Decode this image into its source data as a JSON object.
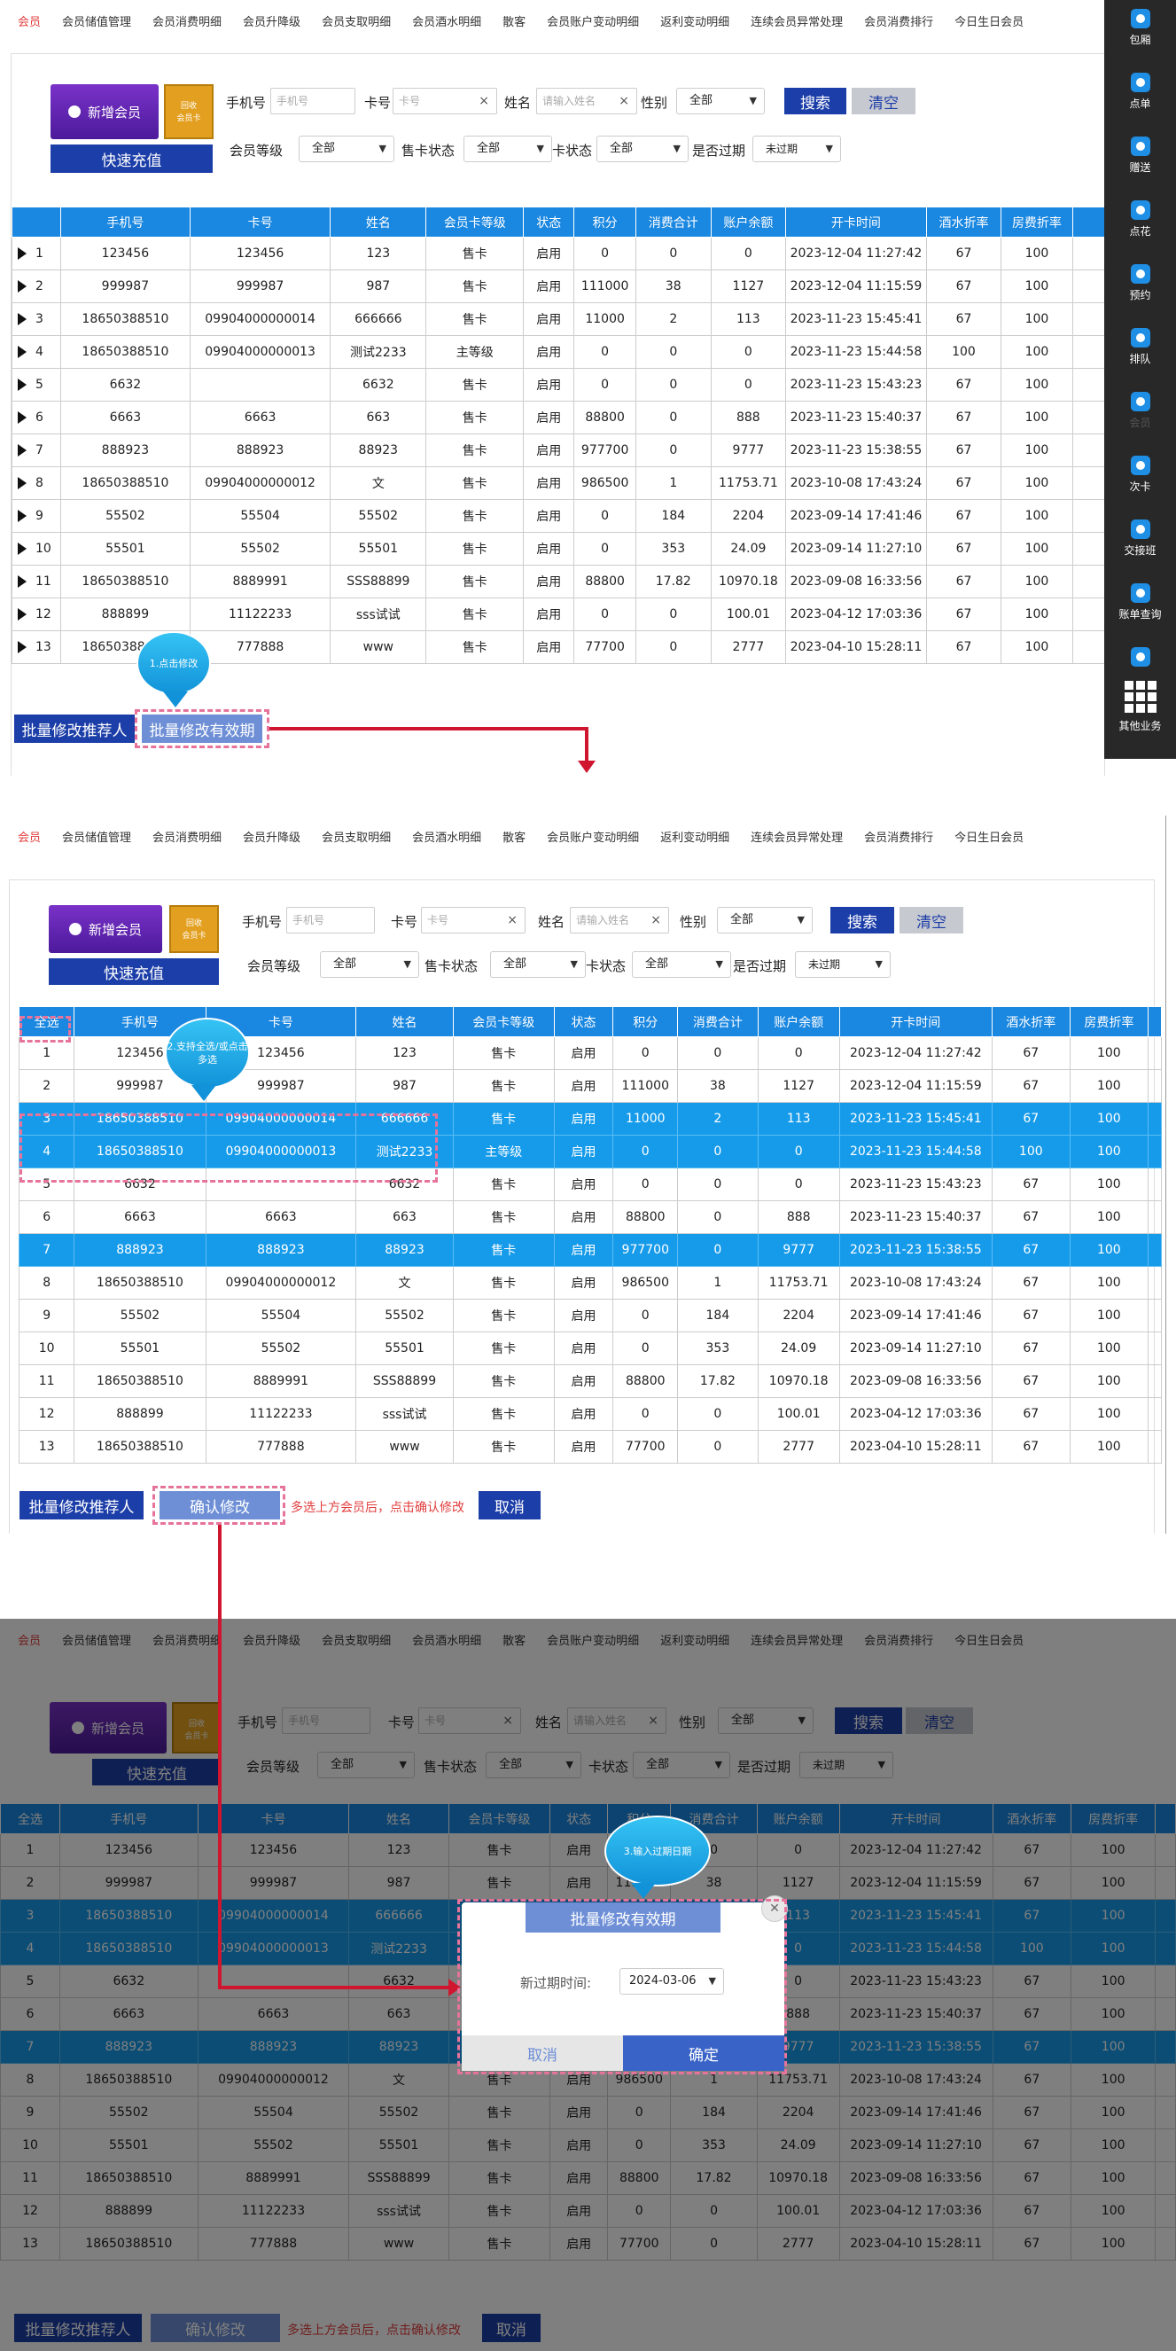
{
  "tabs": [
    "会员",
    "会员储值管理",
    "会员消费明细",
    "会员升降级",
    "会员支取明细",
    "会员酒水明细",
    "散客",
    "会员账户变动明细",
    "返利变动明细",
    "连续会员异常处理",
    "会员消费排行",
    "今日生日会员"
  ],
  "toolbar": {
    "new_member": "新增会员",
    "recycle_line1": "回收",
    "recycle_line2": "会员卡",
    "recharge": "快速充值",
    "phone_label": "手机号",
    "phone_placeholder": "手机号",
    "card_label": "卡号",
    "card_placeholder": "卡号",
    "name_label": "姓名",
    "name_placeholder": "请输入姓名",
    "gender_label": "性别",
    "gender_value": "全部",
    "search": "搜索",
    "clear": "清空",
    "level_label": "会员等级",
    "level_value": "全部",
    "sale_status_label": "售卡状态",
    "sale_status_value": "全部",
    "card_status_label": "卡状态",
    "card_status_value": "全部",
    "expired_label": "是否过期",
    "expired_value": "未过期"
  },
  "columns": [
    "手机号",
    "卡号",
    "姓名",
    "会员卡等级",
    "状态",
    "积分",
    "消费合计",
    "账户余额",
    "开卡时间",
    "酒水折率",
    "房费折率"
  ],
  "select_all": "全选",
  "rows": [
    {
      "no": "1",
      "phone": "123456",
      "card": "123456",
      "name": "123",
      "level": "售卡",
      "status": "启用",
      "points": "0",
      "consume": "0",
      "balance": "0",
      "open": "2023-12-04 11:27:42",
      "drink": "67",
      "room": "100"
    },
    {
      "no": "2",
      "phone": "999987",
      "card": "999987",
      "name": "987",
      "level": "售卡",
      "status": "启用",
      "points": "111000",
      "consume": "38",
      "balance": "1127",
      "open": "2023-12-04 11:15:59",
      "drink": "67",
      "room": "100"
    },
    {
      "no": "3",
      "phone": "18650388510",
      "card": "09904000000014",
      "name": "666666",
      "level": "售卡",
      "status": "启用",
      "points": "11000",
      "consume": "2",
      "balance": "113",
      "open": "2023-11-23 15:45:41",
      "drink": "67",
      "room": "100"
    },
    {
      "no": "4",
      "phone": "18650388510",
      "card": "09904000000013",
      "name": "测试2233",
      "level": "主等级",
      "status": "启用",
      "points": "0",
      "consume": "0",
      "balance": "0",
      "open": "2023-11-23 15:44:58",
      "drink": "100",
      "room": "100"
    },
    {
      "no": "5",
      "phone": "6632",
      "card": "",
      "name": "6632",
      "level": "售卡",
      "status": "启用",
      "points": "0",
      "consume": "0",
      "balance": "0",
      "open": "2023-11-23 15:43:23",
      "drink": "67",
      "room": "100"
    },
    {
      "no": "6",
      "phone": "6663",
      "card": "6663",
      "name": "663",
      "level": "售卡",
      "status": "启用",
      "points": "88800",
      "consume": "0",
      "balance": "888",
      "open": "2023-11-23 15:40:37",
      "drink": "67",
      "room": "100"
    },
    {
      "no": "7",
      "phone": "888923",
      "card": "888923",
      "name": "88923",
      "level": "售卡",
      "status": "启用",
      "points": "977700",
      "consume": "0",
      "balance": "9777",
      "open": "2023-11-23 15:38:55",
      "drink": "67",
      "room": "100"
    },
    {
      "no": "8",
      "phone": "18650388510",
      "card": "09904000000012",
      "name": "文",
      "level": "售卡",
      "status": "启用",
      "points": "986500",
      "consume": "1",
      "balance": "11753.71",
      "open": "2023-10-08 17:43:24",
      "drink": "67",
      "room": "100"
    },
    {
      "no": "9",
      "phone": "55502",
      "card": "55504",
      "name": "55502",
      "level": "售卡",
      "status": "启用",
      "points": "0",
      "consume": "184",
      "balance": "2204",
      "open": "2023-09-14 17:41:46",
      "drink": "67",
      "room": "100"
    },
    {
      "no": "10",
      "phone": "55501",
      "card": "55502",
      "name": "55501",
      "level": "售卡",
      "status": "启用",
      "points": "0",
      "consume": "353",
      "balance": "24.09",
      "open": "2023-09-14 11:27:10",
      "drink": "67",
      "room": "100"
    },
    {
      "no": "11",
      "phone": "18650388510",
      "card": "8889991",
      "name": "SSS88899",
      "level": "售卡",
      "status": "启用",
      "points": "88800",
      "consume": "17.82",
      "balance": "10970.18",
      "open": "2023-09-08 16:33:56",
      "drink": "67",
      "room": "100"
    },
    {
      "no": "12",
      "phone": "888899",
      "card": "11122233",
      "name": "sss试试",
      "level": "售卡",
      "status": "启用",
      "points": "0",
      "consume": "0",
      "balance": "100.01",
      "open": "2023-04-12 17:03:36",
      "drink": "67",
      "room": "100"
    },
    {
      "no": "13",
      "phone": "18650388510",
      "card": "777888",
      "name": "www",
      "level": "售卡",
      "status": "启用",
      "points": "77700",
      "consume": "0",
      "balance": "2777",
      "open": "2023-04-10 15:28:11",
      "drink": "67",
      "room": "100"
    }
  ],
  "bottom": {
    "batch_referrer": "批量修改推荐人",
    "batch_expiry": "批量修改有效期",
    "confirm_modify": "确认修改",
    "hint": "多选上方会员后，点击确认修改",
    "cancel": "取消"
  },
  "bubbles": {
    "b1": "1.点击修改",
    "b2_line1": "2.支持全选/或点击",
    "b2_line2": "多选",
    "b3": "3.输入过期日期"
  },
  "side_menu": [
    "包厢",
    "点单",
    "赠送",
    "点花",
    "预约",
    "排队",
    "会员",
    "次卡",
    "交接班",
    "账单查询",
    "",
    "其他业务"
  ],
  "modal": {
    "title": "批量修改有效期",
    "label": "新过期时间:",
    "date": "2024-03-06",
    "cancel": "取消",
    "ok": "确定",
    "close": "✕"
  },
  "colors": {
    "accent_blue": "#1a87e0",
    "navy": "#1c3ea8",
    "selected_row": "#169bea",
    "active_tab": "#e23d3d",
    "dash": "#e6739b",
    "arrow": "#d0152e"
  }
}
